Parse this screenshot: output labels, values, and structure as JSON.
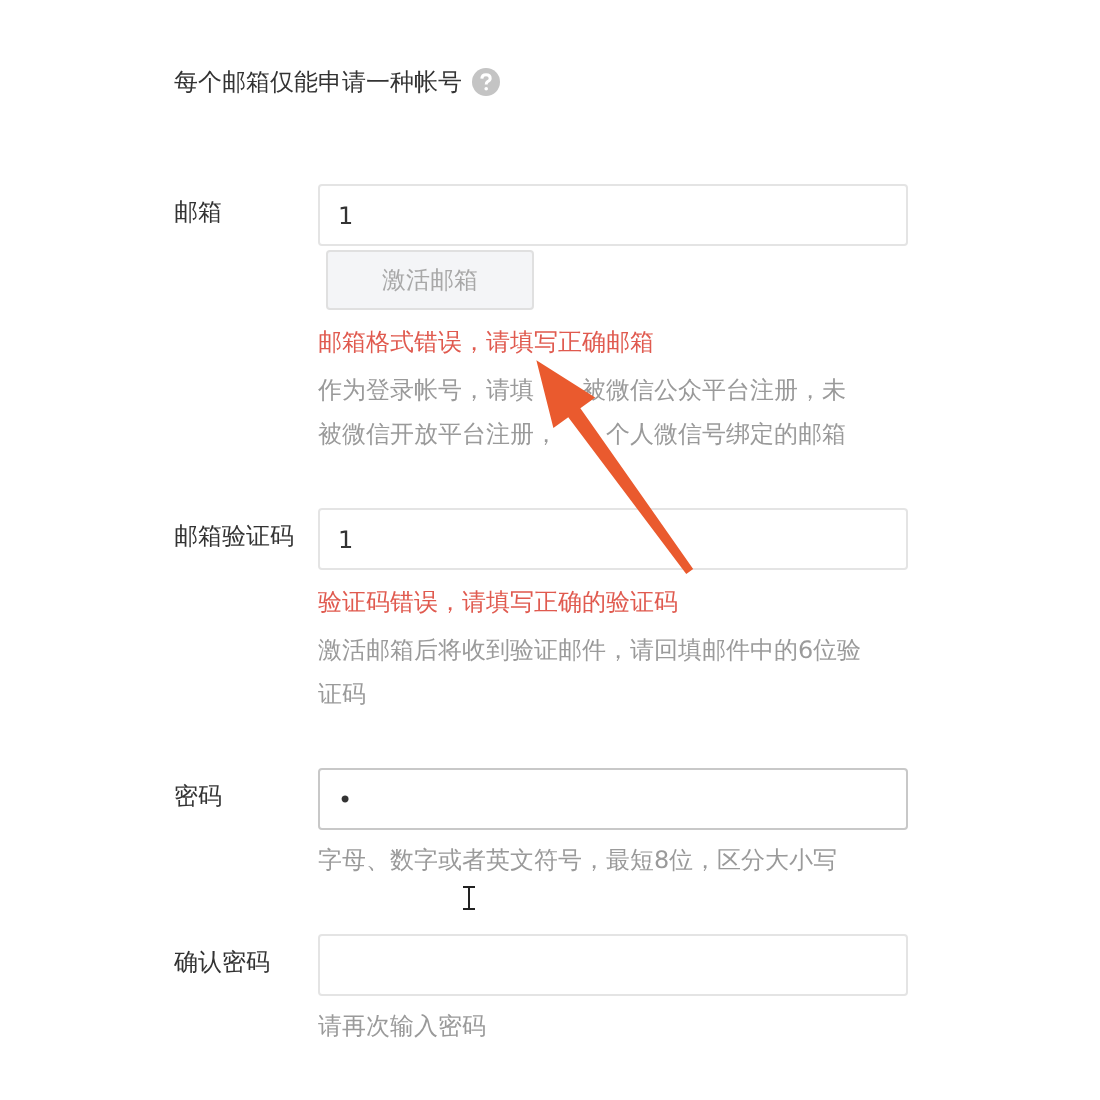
{
  "notice": {
    "text": "每个邮箱仅能申请一种帐号",
    "help": true
  },
  "fields": [
    {
      "label": "邮箱",
      "value": "1",
      "button": {
        "label": "激活邮箱",
        "disabled": true
      },
      "error": "邮箱格式错误，请填写正确邮箱",
      "hint_lines": [
        [
          "作为登录帐号，请填",
          "被微信公众平台注册，未"
        ],
        [
          "被微信开放平台注册，",
          "个人微信号绑定的邮箱"
        ]
      ],
      "focused": false
    },
    {
      "label": "邮箱验证码",
      "value": "1",
      "error": "验证码错误，请填写正确的验证码",
      "hint": "激活邮箱后将收到验证邮件，请回填邮件中的6位验证码",
      "focused": false
    },
    {
      "label": "密码",
      "value": "•",
      "hint": "字母、数字或者英文符号，最短8位，区分大小写",
      "focused": true
    },
    {
      "label": "确认密码",
      "hint": "请再次输入密码",
      "focused": false
    }
  ]
}
